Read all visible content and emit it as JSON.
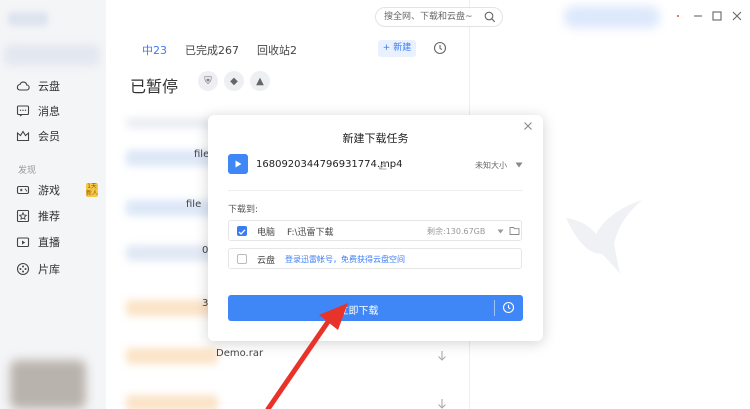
{
  "sidebar": {
    "items": [
      {
        "label": "云盘",
        "icon": "cloud-icon"
      },
      {
        "label": "消息",
        "icon": "message-icon"
      },
      {
        "label": "会员",
        "icon": "vip-icon"
      }
    ],
    "section_label": "发现",
    "discover_items": [
      {
        "label": "游戏",
        "icon": "gamepad-icon"
      },
      {
        "label": "推荐",
        "icon": "recommend-icon"
      },
      {
        "label": "直播",
        "icon": "live-icon"
      },
      {
        "label": "片库",
        "icon": "film-icon"
      }
    ],
    "game_badge": "1天 新人"
  },
  "header": {
    "tabs": [
      {
        "label": "中23"
      },
      {
        "label": "已完成267"
      },
      {
        "label": "回收站2"
      }
    ],
    "new_button": "+ 新建",
    "search_placeholder": "搜全网、下载和云盘~"
  },
  "main": {
    "section_title": "已暂停",
    "status_icons": [
      "shield-icon",
      "diamond-icon",
      "rocket-icon"
    ],
    "row_fragments": [
      "file",
      "file",
      "0",
      "3",
      "Demo.rar"
    ]
  },
  "dialog": {
    "title": "新建下载任务",
    "file_name": "1680920344796931774.mp4",
    "file_size": "未知大小",
    "download_to_label": "下载到:",
    "options": [
      {
        "label": "电脑",
        "path": "F:\\迅雷下载",
        "free": "剩余:130.67GB",
        "checked": true
      },
      {
        "label": "云盘",
        "link": "登录迅雷帐号，免费获得云盘空间",
        "checked": false
      }
    ],
    "download_button": "立即下载"
  },
  "colors": {
    "accent": "#3f86f7",
    "arrow": "#e8332a",
    "sidebar_bg": "#f4f5f7"
  }
}
